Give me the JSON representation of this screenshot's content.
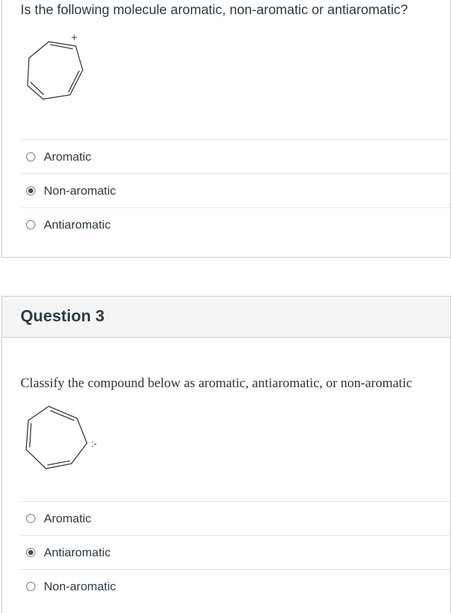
{
  "question_top": {
    "prompt": "Is the following molecule aromatic, non-aromatic or antiaromatic?",
    "charge_label": "+",
    "answers": [
      {
        "label": "Aromatic",
        "selected": false
      },
      {
        "label": "Non-aromatic",
        "selected": true
      },
      {
        "label": "Antiaromatic",
        "selected": false
      }
    ]
  },
  "question3": {
    "title": "Question 3",
    "prompt": "Classify the compound below as aromatic, antiaromatic, or non-aromatic",
    "lone_pair_label": ":-",
    "answers": [
      {
        "label": "Aromatic",
        "selected": false
      },
      {
        "label": "Antiaromatic",
        "selected": true
      },
      {
        "label": "Non-aromatic",
        "selected": false
      }
    ]
  }
}
